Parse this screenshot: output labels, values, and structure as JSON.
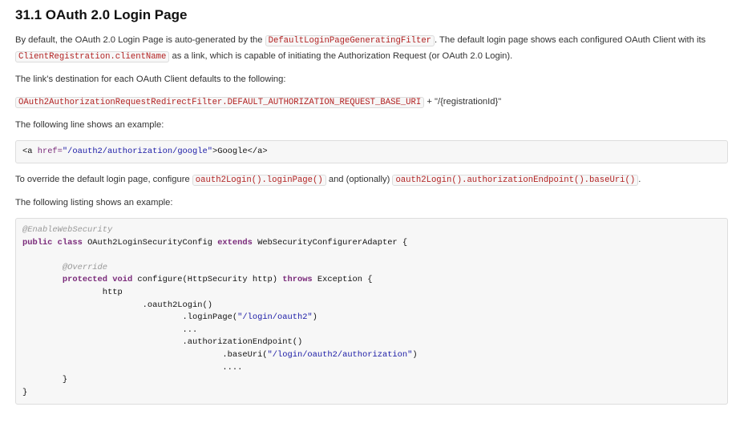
{
  "heading": "31.1 OAuth 2.0 Login Page",
  "para1": {
    "t1": "By default, the OAuth 2.0 Login Page is auto-generated by the ",
    "c1": "DefaultLoginPageGeneratingFilter",
    "t2": ". The default login page shows each configured OAuth Client with its ",
    "c2": "ClientRegistration.clientName",
    "t3": " as a link, which is capable of initiating the Authorization Request (or OAuth 2.0 Login)."
  },
  "para2": "The link’s destination for each OAuth Client defaults to the following:",
  "para3": {
    "c1": "OAuth2AuthorizationRequestRedirectFilter.DEFAULT_AUTHORIZATION_REQUEST_BASE_URI",
    "t1": " + \"/{registrationId}\""
  },
  "para4": "The following line shows an example:",
  "example1": {
    "open": "<a ",
    "attr": "href=",
    "value": "\"/oauth2/authorization/google\"",
    "close": ">Google</a>"
  },
  "para5": {
    "t1": "To override the default login page, configure ",
    "c1": "oauth2Login().loginPage()",
    "t2": " and (optionally) ",
    "c2": "oauth2Login().authorizationEndpoint().baseUri()",
    "t3": "."
  },
  "para6": "The following listing shows an example:",
  "listing": {
    "l1": "@EnableWebSecurity",
    "l2_kw1": "public class",
    "l2_name": " OAuth2LoginSecurityConfig ",
    "l2_kw2": "extends",
    "l2_rest": " WebSecurityConfigurerAdapter {",
    "l4": "@Override",
    "l5_kw1": "protected void",
    "l5_mid": " configure(HttpSecurity http) ",
    "l5_kw2": "throws",
    "l5_rest": " Exception {",
    "l6": "http",
    "l7": ".oauth2Login()",
    "l8_a": ".loginPage(",
    "l8_s": "\"/login/oauth2\"",
    "l8_b": ")",
    "l9": "...",
    "l10": ".authorizationEndpoint()",
    "l11_a": ".baseUri(",
    "l11_s": "\"/login/oauth2/authorization\"",
    "l11_b": ")",
    "l12": "....",
    "l13": "}",
    "l14": "}"
  }
}
